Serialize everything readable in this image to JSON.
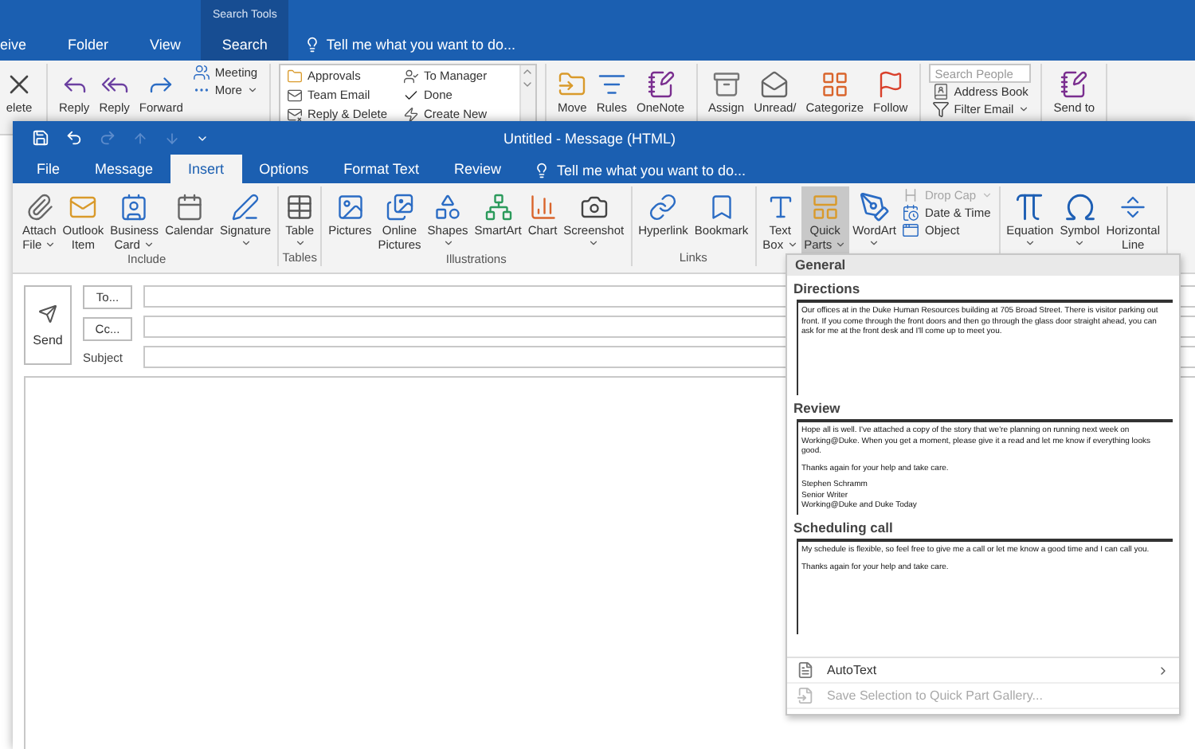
{
  "background_window": {
    "contextual_group": "Search Tools",
    "tabs": [
      {
        "label": "eive",
        "selected": false
      },
      {
        "label": "Folder",
        "selected": false
      },
      {
        "label": "View",
        "selected": false
      },
      {
        "label": "Search",
        "selected": true
      }
    ],
    "tell_me": "Tell me what you want to do...",
    "ribbon_groups": [
      {
        "items": [
          {
            "kind": "large",
            "lines": [
              "elete"
            ]
          }
        ]
      },
      {
        "items": [
          {
            "kind": "large",
            "lines": [
              "Reply"
            ]
          },
          {
            "kind": "large",
            "lines": [
              "Reply"
            ]
          },
          {
            "kind": "large",
            "lines": [
              "Forward"
            ]
          },
          {
            "kind": "stack",
            "items": [
              {
                "label": "Meeting"
              },
              {
                "label": "More",
                "dropdown": true
              }
            ]
          }
        ]
      },
      {
        "items": [
          {
            "kind": "gallery",
            "items": [
              {
                "label": "Approvals"
              },
              {
                "label": "Team Email"
              },
              {
                "label": "Reply & Delete"
              },
              {
                "label": "To Manager"
              },
              {
                "label": "Done"
              },
              {
                "label": "Create New"
              }
            ]
          }
        ]
      },
      {
        "items": [
          {
            "kind": "large",
            "lines": [
              "Move"
            ]
          },
          {
            "kind": "large",
            "lines": [
              "Rules"
            ]
          },
          {
            "kind": "large",
            "lines": [
              "OneNote"
            ]
          }
        ]
      },
      {
        "items": [
          {
            "kind": "large",
            "lines": [
              "Assign"
            ]
          },
          {
            "kind": "large",
            "lines": [
              "Unread/"
            ]
          },
          {
            "kind": "large",
            "lines": [
              "Categorize"
            ]
          },
          {
            "kind": "large",
            "lines": [
              "Follow"
            ]
          }
        ]
      },
      {
        "items": [
          {
            "kind": "stack",
            "field": {
              "placeholder": "Search People"
            },
            "items": [
              {
                "label": "Address Book"
              },
              {
                "label": "Filter Email",
                "dropdown": true
              }
            ]
          }
        ]
      },
      {
        "items": [
          {
            "kind": "large",
            "lines": [
              "Send to"
            ]
          }
        ]
      }
    ]
  },
  "message_window": {
    "title": "Untitled - Message (HTML)",
    "tabs": [
      {
        "label": "File",
        "selected": false
      },
      {
        "label": "Message",
        "selected": false
      },
      {
        "label": "Insert",
        "selected": true
      },
      {
        "label": "Options",
        "selected": false
      },
      {
        "label": "Format Text",
        "selected": false
      },
      {
        "label": "Review",
        "selected": false
      }
    ],
    "tell_me": "Tell me what you want to do...",
    "ribbon_groups": [
      {
        "label": "Include",
        "items": [
          {
            "kind": "large",
            "lines": [
              "Attach",
              "File"
            ],
            "dropdown": true,
            "selected": false
          },
          {
            "kind": "large",
            "lines": [
              "Outlook",
              "Item"
            ],
            "selected": false
          },
          {
            "kind": "large",
            "lines": [
              "Business",
              "Card"
            ],
            "dropdown": true,
            "selected": false
          },
          {
            "kind": "large",
            "lines": [
              "Calendar"
            ],
            "selected": false
          },
          {
            "kind": "large",
            "lines": [
              "Signature"
            ],
            "dropdown": true,
            "selected": false
          }
        ]
      },
      {
        "label": "Tables",
        "items": [
          {
            "kind": "large",
            "lines": [
              "Table"
            ],
            "dropdown": true,
            "selected": false
          }
        ]
      },
      {
        "label": "Illustrations",
        "items": [
          {
            "kind": "large",
            "lines": [
              "Pictures"
            ],
            "selected": false
          },
          {
            "kind": "large",
            "lines": [
              "Online",
              "Pictures"
            ],
            "selected": false
          },
          {
            "kind": "large",
            "lines": [
              "Shapes"
            ],
            "dropdown": true,
            "selected": false
          },
          {
            "kind": "large",
            "lines": [
              "SmartArt"
            ],
            "selected": false
          },
          {
            "kind": "large",
            "lines": [
              "Chart"
            ],
            "selected": false
          },
          {
            "kind": "large",
            "lines": [
              "Screenshot"
            ],
            "dropdown": true,
            "selected": false
          }
        ]
      },
      {
        "label": "Links",
        "items": [
          {
            "kind": "large",
            "lines": [
              "Hyperlink"
            ],
            "selected": false
          },
          {
            "kind": "large",
            "lines": [
              "Bookmark"
            ],
            "selected": false
          }
        ]
      },
      {
        "items": [
          {
            "kind": "large",
            "lines": [
              "Text",
              "Box"
            ],
            "dropdown": true,
            "selected": false
          },
          {
            "kind": "large",
            "lines": [
              "Quick",
              "Parts"
            ],
            "dropdown": true,
            "selected": true
          },
          {
            "kind": "large",
            "lines": [
              "WordArt"
            ],
            "dropdown": true,
            "selected": false
          },
          {
            "kind": "stack",
            "items": [
              {
                "label": "Drop Cap",
                "dropdown": true,
                "disabled": true
              },
              {
                "label": "Date & Time",
                "disabled": false
              },
              {
                "label": "Object",
                "disabled": false
              }
            ]
          }
        ]
      },
      {
        "items": [
          {
            "kind": "large",
            "lines": [
              "Equation"
            ],
            "dropdown": true,
            "selected": false
          },
          {
            "kind": "large",
            "lines": [
              "Symbol"
            ],
            "dropdown": true,
            "selected": false
          },
          {
            "kind": "large",
            "lines": [
              "Horizontal",
              "Line"
            ],
            "selected": false
          }
        ]
      }
    ],
    "header": {
      "send": "Send",
      "to": "To...",
      "cc": "Cc...",
      "subject_label": "Subject"
    },
    "quick_parts_menu": {
      "header": "General",
      "entries": [
        {
          "title": "Directions",
          "paragraphs": [
            [
              "Our offices at in the Duke Human Resources building at 705 Broad Street. There is visitor parking out front. If you come through the front doors and then go through the glass door straight ahead, you can ask for me at the front desk and I'll come up to meet you."
            ]
          ]
        },
        {
          "title": "Review",
          "paragraphs": [
            [
              "Hope all is well. I've attached a copy of the story that we're planning on running next week on Working@Duke. When you get a moment, please give it a read and let me know if everything looks good."
            ],
            [
              "Thanks again for your help and take care."
            ],
            [
              "Stephen Schramm",
              "Senior Writer",
              "Working@Duke and Duke Today"
            ]
          ]
        },
        {
          "title": "Scheduling call",
          "paragraphs": [
            [
              "My schedule is flexible, so feel free to give me a call or let me know a good time and I can call you."
            ],
            [
              "Thanks again for your help and take care."
            ]
          ]
        }
      ],
      "commands": [
        {
          "label": "AutoText",
          "submenu": true,
          "disabled": false
        },
        {
          "label": "Save Selection to Quick Part Gallery...",
          "disabled": true
        }
      ]
    }
  }
}
